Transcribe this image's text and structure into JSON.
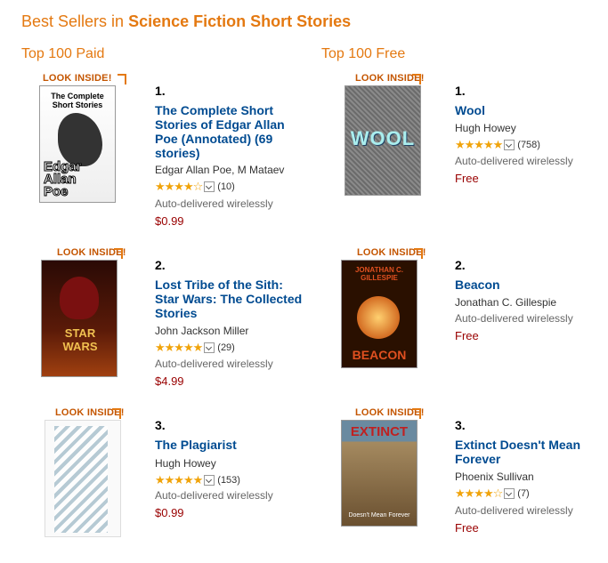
{
  "header": {
    "prefix": "Best Sellers in ",
    "category": "Science Fiction Short Stories"
  },
  "columns": {
    "paid_label": "Top 100 Paid",
    "free_label": "Top 100 Free"
  },
  "look_inside": "LOOK INSIDE!",
  "paid": [
    {
      "rank": "1.",
      "title": "The Complete Short Stories of Edgar Allan Poe (Annotated) (69 stories)",
      "author": "Edgar Allan Poe, M Mataev",
      "rating": 4,
      "reviews": "(10)",
      "delivery": "Auto-delivered wirelessly",
      "price": "$0.99",
      "cover_title": "The Complete Short Stories",
      "cover_author": "Edgar Allan Poe"
    },
    {
      "rank": "2.",
      "title": "Lost Tribe of the Sith: Star Wars: The Collected Stories",
      "author": "John Jackson Miller",
      "rating": 4.5,
      "reviews": "(29)",
      "delivery": "Auto-delivered wirelessly",
      "price": "$4.99",
      "cover_title": "STAR WARS"
    },
    {
      "rank": "3.",
      "title": "The Plagiarist",
      "author": "Hugh Howey",
      "rating": 4.5,
      "reviews": "(153)",
      "delivery": "Auto-delivered wirelessly",
      "price": "$0.99"
    }
  ],
  "free": [
    {
      "rank": "1.",
      "title": "Wool",
      "author": "Hugh Howey",
      "rating": 4.5,
      "reviews": "(758)",
      "delivery": "Auto-delivered wirelessly",
      "price": "Free",
      "cover_title": "WOOL"
    },
    {
      "rank": "2.",
      "title": "Beacon",
      "author": "Jonathan C. Gillespie",
      "delivery": "Auto-delivered wirelessly",
      "price": "Free",
      "cover_title": "BEACON",
      "cover_author": "JONATHAN C. GILLESPIE"
    },
    {
      "rank": "3.",
      "title": "Extinct Doesn't Mean Forever",
      "author": "Phoenix Sullivan",
      "rating": 4,
      "reviews": "(7)",
      "delivery": "Auto-delivered wirelessly",
      "price": "Free",
      "cover_title": "EXTINCT",
      "cover_subtitle": "Doesn't Mean Forever"
    }
  ],
  "colors": {
    "heading": "#e47911",
    "link": "#004b91",
    "price": "#990000",
    "star": "#f0a30a"
  }
}
